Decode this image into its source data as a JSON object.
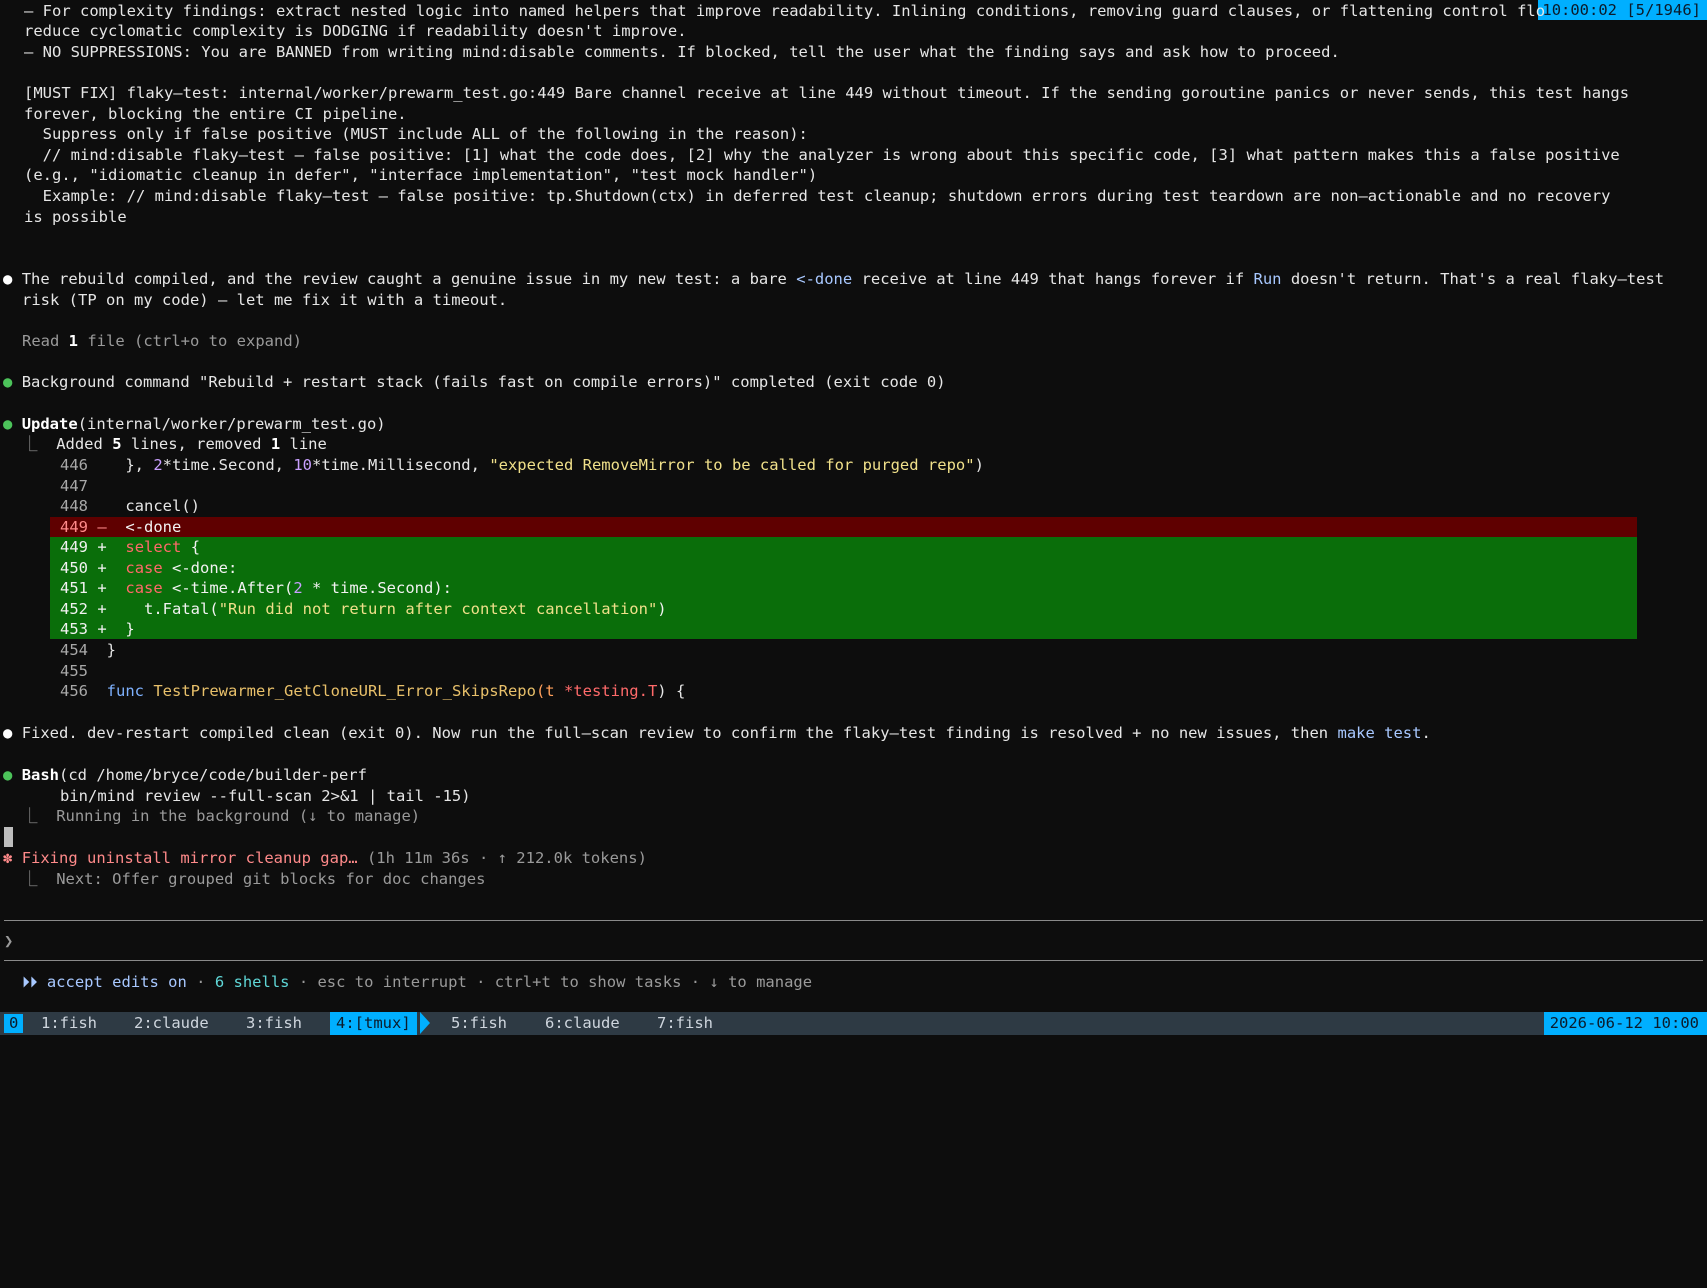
{
  "header_badge": "10:00:02 [5/1946]",
  "review_text": {
    "line1": "– For complexity findings: extract nested logic into named helpers that improve readability. Inlining conditions, removing guard clauses, or flattening control flo",
    "line2": "reduce cyclomatic complexity is DODGING if readability doesn't improve.",
    "line3": "– NO SUPPRESSIONS: You are BANNED from writing mind:disable comments. If blocked, tell the user what the finding says and ask how to proceed.",
    "line4": "[MUST FIX] flaky–test: internal/worker/prewarm_test.go:449 Bare channel receive at line 449 without timeout. If the sending goroutine panics or never sends, this test hangs",
    "line5": "forever, blocking the entire CI pipeline.",
    "line6": "  Suppress only if false positive (MUST include ALL of the following in the reason):",
    "line7": "  // mind:disable flaky–test – false positive: [1] what the code does, [2] why the analyzer is wrong about this specific code, [3] what pattern makes this a false positive",
    "line8": "(e.g., \"idiomatic cleanup in defer\", \"interface implementation\", \"test mock handler\")",
    "line9": "  Example: // mind:disable flaky–test – false positive: tp.Shutdown(ctx) in deferred test cleanup; shutdown errors during test teardown are non–actionable and no recovery",
    "line10": "is possible"
  },
  "assistant_msg1": {
    "bullet": "●",
    "a": "The rebuild compiled, and the review caught a genuine issue in my new test: a bare ",
    "code1": "<-done",
    "b": " receive at line 449 that hangs forever if ",
    "code2": "Run",
    "c": " doesn't return. That's a real flaky–test",
    "d": "risk (TP on my code) – let me fix it with a timeout."
  },
  "read_line": {
    "prefix": "Read ",
    "count": "1",
    "suffix": " file (ctrl+o to expand)"
  },
  "background_done": {
    "bullet": "●",
    "text": "Background command \"Rebuild + restart stack (fails fast on compile errors)\" completed (exit code 0)"
  },
  "update_tool": {
    "bullet": "●",
    "name": "Update",
    "arg": "(internal/worker/prewarm_test.go)",
    "summary_prefix": "Added ",
    "added": "5",
    "summary_mid": " lines, removed ",
    "removed": "1",
    "summary_suffix": " line"
  },
  "diff": {
    "l446": {
      "num": "446",
      "p1": "}, ",
      "n1": "2",
      "p2": "*time.Second, ",
      "n2": "10",
      "p3": "*time.Millisecond, ",
      "s": "\"expected RemoveMirror to be called for purged repo\"",
      "p4": ")"
    },
    "l447": {
      "num": "447"
    },
    "l448": {
      "num": "448",
      "code": "cancel()"
    },
    "l449d": {
      "num": "449",
      "sign": "–",
      "code": "<-done"
    },
    "l449": {
      "num": "449",
      "sign": "+",
      "kw": "select",
      "rest": " {"
    },
    "l450": {
      "num": "450",
      "sign": "+",
      "kw": "case",
      "rest": " <-done:"
    },
    "l451": {
      "num": "451",
      "sign": "+",
      "kw": "case",
      "rest1": " <-time.After(",
      "n": "2",
      "rest2": " * time.Second):"
    },
    "l452": {
      "num": "452",
      "sign": "+",
      "rest1": "  t.Fatal(",
      "s": "\"Run did not return after context cancellation\"",
      "rest2": ")"
    },
    "l453": {
      "num": "453",
      "sign": "+",
      "code": "}"
    },
    "l454": {
      "num": "454",
      "code": "}"
    },
    "l455": {
      "num": "455"
    },
    "l456": {
      "num": "456",
      "kw": "func",
      "fn": "TestPrewarmer_GetCloneURL_Error_SkipsRepo",
      "p1": "(t ",
      "typ": "*testing.T",
      "p2": ") {"
    }
  },
  "assistant_msg2": {
    "bullet": "●",
    "text": "Fixed. dev-restart compiled clean (exit 0). Now run the full–scan review to confirm the flaky–test finding is resolved + no new issues, then ",
    "code": "make test",
    "end": "."
  },
  "bash_tool": {
    "bullet": "●",
    "name": "Bash",
    "arg1": "(cd /home/bryce/code/builder-perf",
    "arg2": "bin/mind review --full-scan 2>&1 | tail -15)",
    "status": "Running in the background (↓ to manage)"
  },
  "spinner": {
    "glyph": "✽",
    "task": "Fixing uninstall mirror cleanup gap…",
    "meta": " (1h 11m 36s · ↑ 212.0k tokens)",
    "next": "Next: Offer grouped git blocks for doc changes"
  },
  "prompt": {
    "glyph": "❯"
  },
  "footer": {
    "arrows": "⏵⏵",
    "mode": " accept edits on",
    "sep1": " · ",
    "shells": "6 shells",
    "rest": " · esc to interrupt · ctrl+t to show tasks · ↓ to manage"
  },
  "tmux": {
    "session": "0",
    "windows": [
      "1:fish",
      "2:claude",
      "3:fish",
      "4:[tmux]",
      "5:fish",
      "6:claude",
      "7:fish"
    ],
    "clock": "2026-06-12 10:00"
  },
  "colors": {
    "background": "#0d0d0d",
    "diff_removed": "#5f0000",
    "diff_added": "#0a6e0a",
    "accent": "#00afff",
    "tmux_bar": "#2e3a44"
  }
}
